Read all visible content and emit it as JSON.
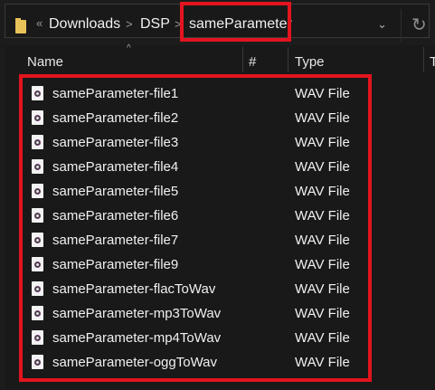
{
  "address_bar": {
    "overflow": "«",
    "breadcrumbs": [
      "Downloads",
      "DSP",
      "sameParameter"
    ],
    "separator": ">"
  },
  "columns": {
    "name": "Name",
    "number": "#",
    "type": "Type",
    "extra": "T"
  },
  "files": [
    {
      "name": "sameParameter-file1",
      "type": "WAV File"
    },
    {
      "name": "sameParameter-file2",
      "type": "WAV File"
    },
    {
      "name": "sameParameter-file3",
      "type": "WAV File"
    },
    {
      "name": "sameParameter-file4",
      "type": "WAV File"
    },
    {
      "name": "sameParameter-file5",
      "type": "WAV File"
    },
    {
      "name": "sameParameter-file6",
      "type": "WAV File"
    },
    {
      "name": "sameParameter-file7",
      "type": "WAV File"
    },
    {
      "name": "sameParameter-file9",
      "type": "WAV File"
    },
    {
      "name": "sameParameter-flacToWav",
      "type": "WAV File"
    },
    {
      "name": "sameParameter-mp3ToWav",
      "type": "WAV File"
    },
    {
      "name": "sameParameter-mp4ToWav",
      "type": "WAV File"
    },
    {
      "name": "sameParameter-oggToWav",
      "type": "WAV File"
    }
  ],
  "colors": {
    "highlight": "#e3141f",
    "folder": "#e8c35a"
  }
}
